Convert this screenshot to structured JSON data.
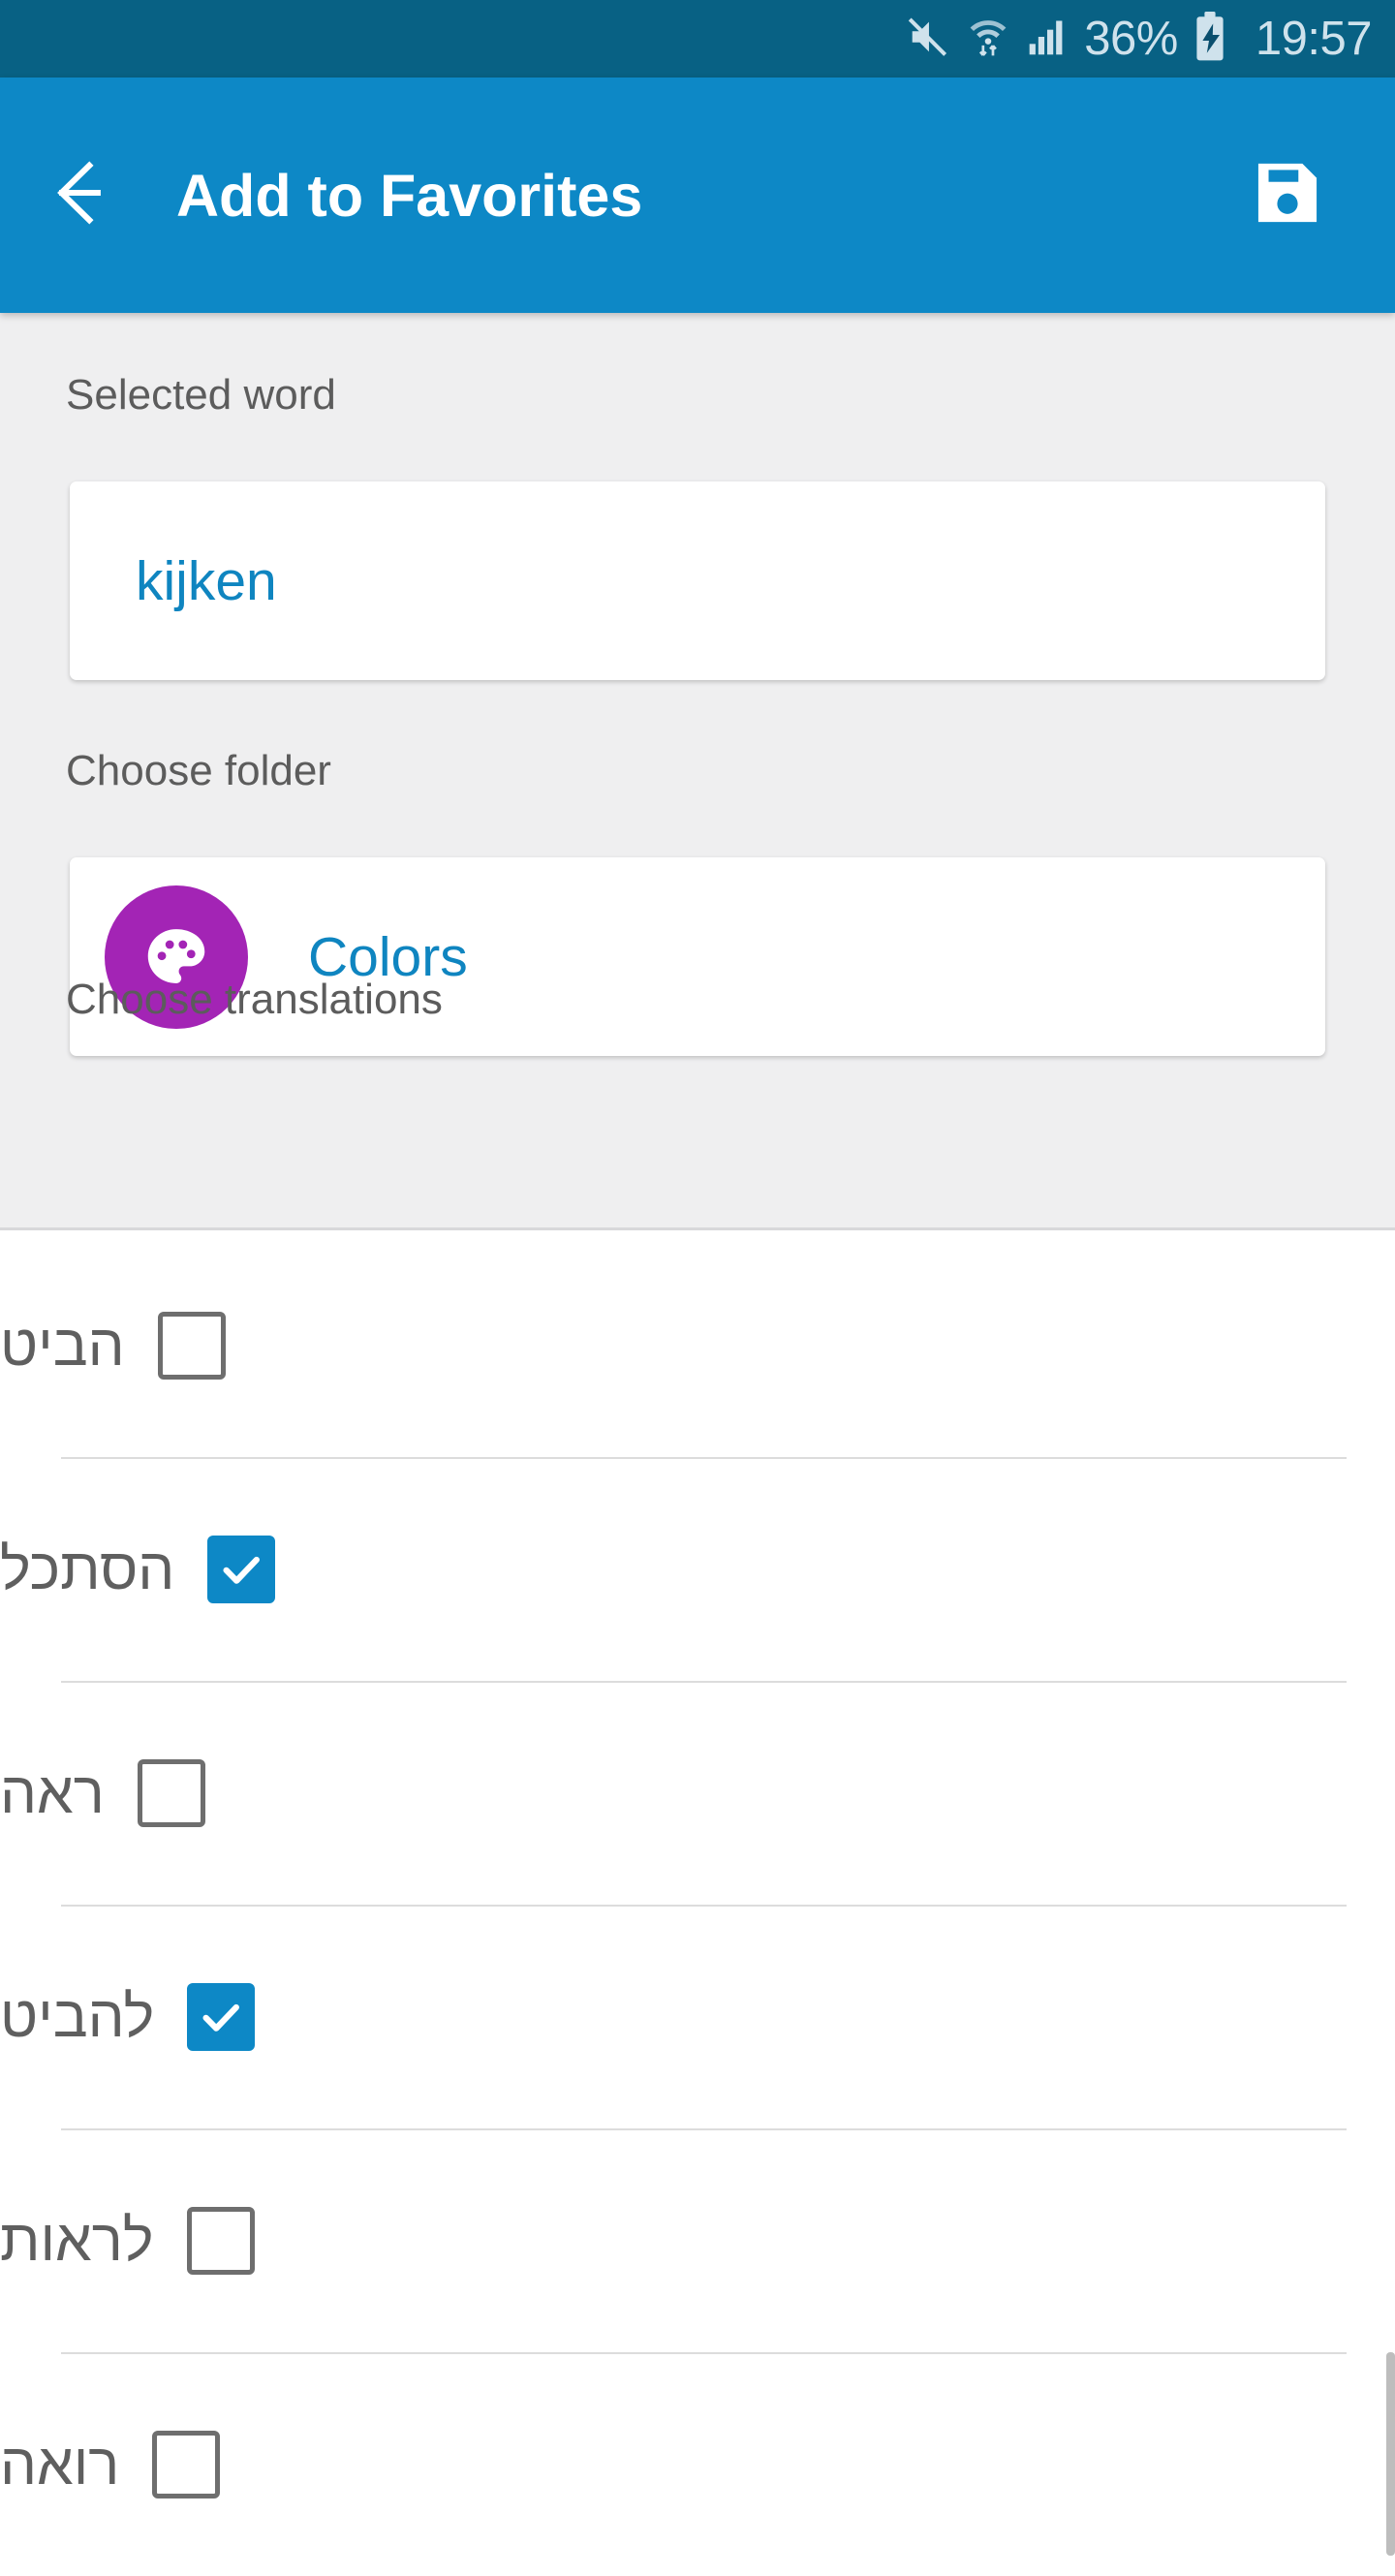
{
  "status_bar": {
    "mute_icon": "mute-icon",
    "wifi_icon": "wifi-transfer-icon",
    "signal_icon": "cellular-signal-icon",
    "battery_percent": "36%",
    "battery_icon": "battery-charging-icon",
    "clock": "19:57",
    "background_color": "#086184",
    "text_color": "#cfe2ec"
  },
  "app_bar": {
    "back_icon": "arrow-left-icon",
    "title": "Add to Favorites",
    "save_icon": "floppy-disk-save-icon",
    "background_color": "#0d88c6",
    "text_color": "#ffffff"
  },
  "form": {
    "selected_word": {
      "label": "Selected word",
      "value": "kijken",
      "value_color": "#0f85c0"
    },
    "choose_folder": {
      "label": "Choose folder",
      "folder_name": "Colors",
      "folder_icon": "palette-icon",
      "folder_icon_color": "#a324b5",
      "value_color": "#0f85c0"
    },
    "choose_translations": {
      "label": "Choose translations"
    },
    "background_color": "#efeff0",
    "label_color": "#5c5c5c"
  },
  "translations": [
    {
      "label": "הביט",
      "checked": false
    },
    {
      "label": "הסתכל",
      "checked": true
    },
    {
      "label": "ראה",
      "checked": false
    },
    {
      "label": "להביט",
      "checked": true
    },
    {
      "label": "לראות",
      "checked": false
    },
    {
      "label": "רואה",
      "checked": false
    }
  ],
  "list": {
    "checked_color": "#0d88c6",
    "unchecked_border_color": "#6e6e6e",
    "label_color": "#5f5f5f",
    "divider_color": "#dcdcdc"
  }
}
